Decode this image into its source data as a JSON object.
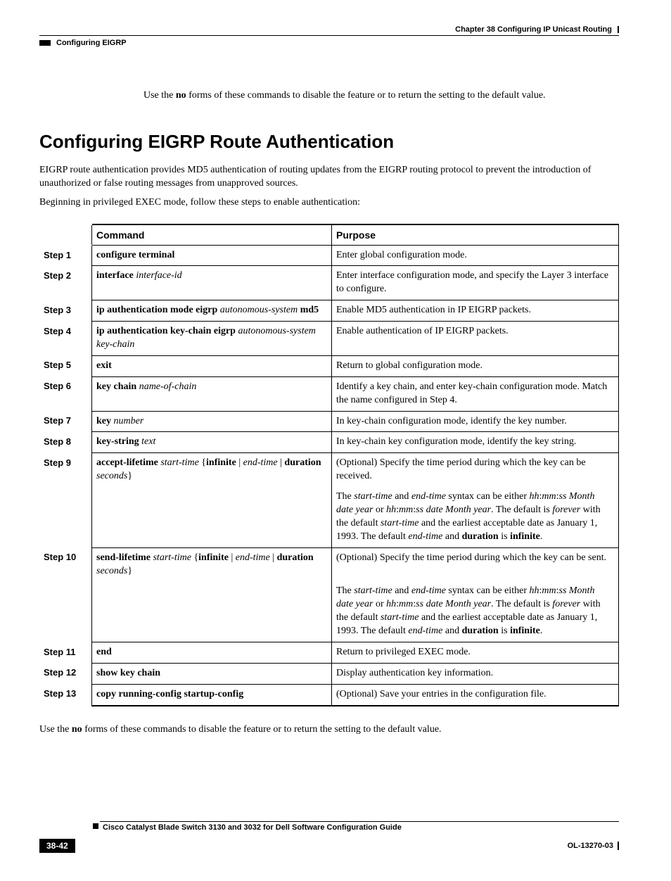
{
  "header": {
    "chapter": "Chapter 38    Configuring IP Unicast Routing",
    "section": "Configuring EIGRP"
  },
  "intro1_pre": "Use the ",
  "intro1_bold": "no",
  "intro1_post": " forms of these commands to disable the feature or to return the setting to the default value.",
  "h1": "Configuring EIGRP Route Authentication",
  "para1": "EIGRP route authentication provides MD5 authentication of routing updates from the EIGRP routing protocol to prevent the introduction of unauthorized or false routing messages from unapproved sources.",
  "para2": "Beginning in privileged EXEC mode, follow these steps to enable authentication:",
  "table": {
    "h_cmd": "Command",
    "h_purp": "Purpose",
    "rows": [
      {
        "step": "Step 1",
        "cmd_html": "<span class='b'>configure terminal</span>",
        "purp_html": "Enter global configuration mode."
      },
      {
        "step": "Step 2",
        "cmd_html": "<span class='b'>interface</span> <span class='i'>interface-id</span>",
        "purp_html": "Enter interface configuration mode, and specify the Layer 3 interface to configure."
      },
      {
        "step": "Step 3",
        "cmd_html": "<span class='b'>ip authentication mode eigrp</span> <span class='i'>autonomous-system</span> <span class='b'>md5</span>",
        "purp_html": "Enable MD5 authentication in IP EIGRP packets."
      },
      {
        "step": "Step 4",
        "cmd_html": "<span class='b'>ip authentication key-chain eigrp</span> <span class='i'>autonomous-system key-chain</span>",
        "purp_html": "Enable authentication of IP EIGRP packets."
      },
      {
        "step": "Step 5",
        "cmd_html": "<span class='b'>exit</span>",
        "purp_html": "Return to global configuration mode."
      },
      {
        "step": "Step 6",
        "cmd_html": "<span class='b'>key chain</span> <span class='i'>name-of-chain</span>",
        "purp_html": "Identify a key chain, and enter key-chain configuration mode. Match the name configured in Step 4."
      },
      {
        "step": "Step 7",
        "cmd_html": "<span class='b'>key</span> <span class='i'>number</span>",
        "purp_html": "In key-chain configuration mode, identify the key number."
      },
      {
        "step": "Step 8",
        "cmd_html": "<span class='b'>key-string</span> <span class='i'>text</span>",
        "purp_html": "In key-chain key configuration mode, identify the key string."
      },
      {
        "step": "Step 9",
        "cmd_html": "<span class='b'>accept-lifetime</span> <span class='i'>start-time</span> {<span class='b'>infinite</span> | <span class='i'>end-time</span> | <span class='b'>duration</span> <span class='i'>seconds</span>}",
        "purp_html": "(Optional) Specify the time period during which the key can be received.",
        "extra_html": "The <span class='i'>start-time</span> and <span class='i'>end-time</span> syntax can be either <span class='i'>hh</span>:<span class='i'>mm</span>:<span class='i'>ss Month date year</span> or <span class='i'>hh</span>:<span class='i'>mm</span>:<span class='i'>ss date Month year</span>. The default is <span class='i'>forever</span> with the default <span class='i'>start-time</span> and the earliest acceptable date as January 1, 1993. The default <span class='i'>end-time</span> and <span class='b'>duration</span> is <span class='b'>infinite</span>."
      },
      {
        "step": "Step 10",
        "cmd_html": "<span class='b'>send-lifetime</span> <span class='i'>start-time</span> {<span class='b'>infinite</span> | <span class='i'>end-time</span> | <span class='b'>duration</span> <span class='i'>seconds</span>}",
        "purp_html": "(Optional) Specify the time period during which the key can be sent.",
        "extra_html": "The <span class='i'>start-time</span> and <span class='i'>end-time</span> syntax can be either <span class='i'>hh</span>:<span class='i'>mm</span>:<span class='i'>ss Month date year</span> or <span class='i'>hh</span>:<span class='i'>mm</span>:<span class='i'>ss date Month year</span>. The default is <span class='i'>forever</span> with the default <span class='i'>start-time</span> and the earliest acceptable date as January 1, 1993. The default <span class='i'>end-time</span> and <span class='b'>duration</span> is <span class='b'>infinite</span>."
      },
      {
        "step": "Step 11",
        "cmd_html": "<span class='b'>end</span>",
        "purp_html": "Return to privileged EXEC mode."
      },
      {
        "step": "Step 12",
        "cmd_html": "<span class='b'>show key chain</span>",
        "purp_html": "Display authentication key information."
      },
      {
        "step": "Step 13",
        "cmd_html": "<span class='b'>copy running-config startup-config</span>",
        "purp_html": "(Optional) Save your entries in the configuration file.",
        "last": true
      }
    ]
  },
  "closing_pre": "Use the ",
  "closing_bold": "no",
  "closing_post": " forms of these commands to disable the feature or to return the setting to the default value.",
  "footer": {
    "title": "Cisco Catalyst Blade Switch 3130 and 3032 for Dell Software Configuration Guide",
    "page": "38-42",
    "docid": "OL-13270-03"
  }
}
